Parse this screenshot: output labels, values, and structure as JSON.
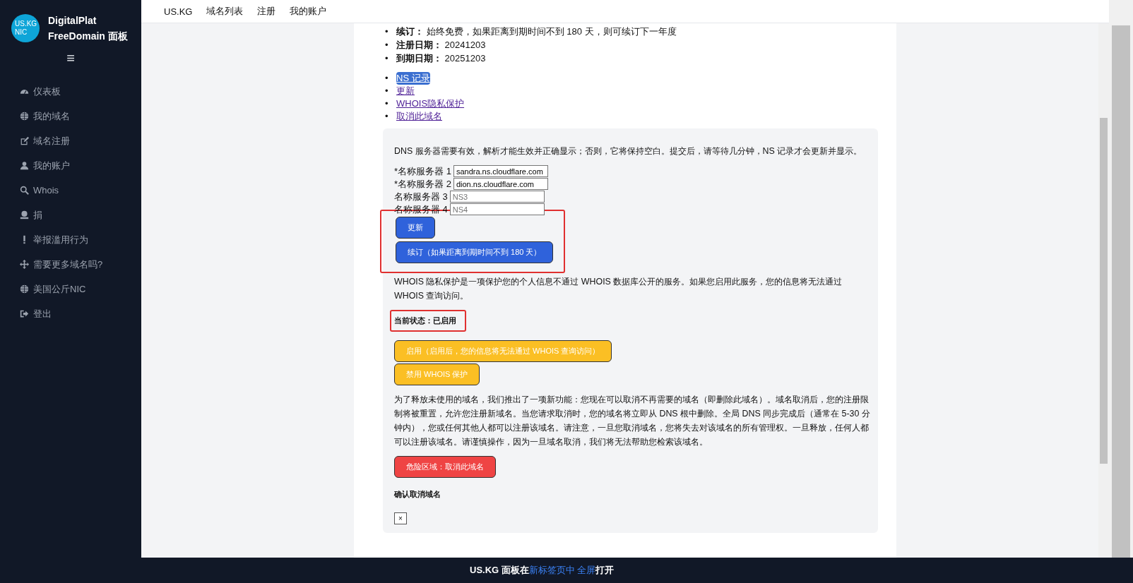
{
  "sidebar": {
    "logo": "US.KG NIC",
    "title": "DigitalPlat FreeDomain 面板",
    "menu_icon": "≡",
    "items": [
      {
        "label": "仪表板"
      },
      {
        "label": "我的域名"
      },
      {
        "label": "域名注册"
      },
      {
        "label": "我的账户"
      },
      {
        "label": "Whois"
      },
      {
        "label": "捐"
      },
      {
        "label": "举报滥用行为"
      },
      {
        "label": "需要更多域名吗?"
      },
      {
        "label": "美国公斤NIC"
      },
      {
        "label": "登出"
      }
    ]
  },
  "top_nav": [
    "US.KG",
    "域名列表",
    "注册",
    "我的账户"
  ],
  "details": [
    {
      "bullet": "•",
      "label": "续订：",
      "value": "始终免费，如果距离到期时间不到 180 天，则可续订下一年度"
    },
    {
      "bullet": "•",
      "label": "注册日期：",
      "value": "20241203"
    },
    {
      "bullet": "•",
      "label": "到期日期：",
      "value": "20251203"
    }
  ],
  "links": [
    {
      "bullet": "•",
      "label": "NS 记录",
      "highlighted": true
    },
    {
      "bullet": "•",
      "label": "更新",
      "highlighted": false
    },
    {
      "bullet": "•",
      "label": "WHOIS隐私保护",
      "highlighted": false
    },
    {
      "bullet": "•",
      "label": "取消此域名",
      "highlighted": false
    }
  ],
  "dns": {
    "note": "DNS 服务器需要有效，解析才能生效并正确显示；否则，它将保持空白。提交后，请等待几分钟，NS 记录才会更新并显示。",
    "servers": [
      {
        "label": "*名称服务器 1",
        "value": "sandra.ns.cloudflare.com"
      },
      {
        "label": "*名称服务器 2",
        "value": "dion.ns.cloudflare.com"
      },
      {
        "label": "名称服务器 3",
        "placeholder": "NS3"
      },
      {
        "label": "名称服务器 4",
        "placeholder": "NS4"
      }
    ],
    "buttons_marked": true,
    "buttons": [
      "更新",
      "续订（如果距离到期时间不到 180 天）"
    ]
  },
  "whois": {
    "note": "WHOIS 隐私保护是一项保护您的个人信息不通过 WHOIS 数据库公开的服务。如果您启用此服务，您的信息将无法通过 WHOIS 查询访问。",
    "status": "当前状态：已启用",
    "status_marked": true,
    "buttons": [
      "启用（启用后，您的信息将无法通过 WHOIS 查询访问）",
      "禁用 WHOIS 保护"
    ]
  },
  "cancel": {
    "note": "为了释放未使用的域名，我们推出了一项新功能：您现在可以取消不再需要的域名（即删除此域名）。域名取消后，您的注册限制将被重置，允许您注册新域名。当您请求取消时，您的域名将立即从 DNS 根中删除。全局 DNS 同步完成后（通常在 5-30 分钟内），您或任何其他人都可以注册该域名。请注意，一旦您取消域名，您将失去对该域名的所有管理权。一旦释放，任何人都可以注册该域名。请谨慎操作，因为一旦域名取消，我们将无法帮助您检索该域名。",
    "button": "危险区域：取消此域名",
    "confirm_title": "确认取消域名",
    "close": "×"
  },
  "footer": {
    "text1": "US.KG 面板在",
    "link1": "新标签页中",
    "link2": "全屏",
    "text2": "打开"
  }
}
